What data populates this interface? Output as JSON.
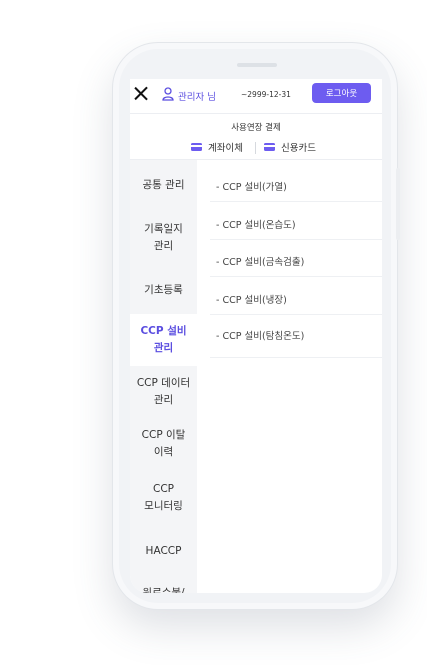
{
  "header": {
    "close_icon": "close-icon",
    "user_icon": "user-icon",
    "user_label": "관리자 님",
    "date": "~2999-12-31",
    "logout_label": "로그아웃"
  },
  "extension": {
    "title": "사용연장 결제",
    "options": [
      {
        "icon": "card-icon",
        "label": "계좌이체"
      },
      {
        "icon": "card-icon",
        "label": "신용카드"
      }
    ]
  },
  "sidebar": {
    "items": [
      {
        "label": "공통 관리"
      },
      {
        "label": "기록일지\n관리"
      },
      {
        "label": "기초등록"
      },
      {
        "label": "CCP 설비\n관리",
        "active": true
      },
      {
        "label": "CCP 데이터\n관리"
      },
      {
        "label": "CCP 이탈\n이력"
      },
      {
        "label": "CCP\n모니터링"
      },
      {
        "label": "HACCP"
      },
      {
        "label": "원료수불/"
      }
    ]
  },
  "submenu": {
    "items": [
      {
        "label": "- CCP 설비(가열)"
      },
      {
        "label": "- CCP 설비(온습도)"
      },
      {
        "label": "- CCP 설비(금속검출)"
      },
      {
        "label": "- CCP 설비(냉장)"
      },
      {
        "label": "- CCP 설비(탐침온도)"
      }
    ]
  },
  "colors": {
    "accent": "#6d5cf0",
    "accent_text": "#5b4ee0",
    "sidebar_bg": "#f4f5f7"
  }
}
